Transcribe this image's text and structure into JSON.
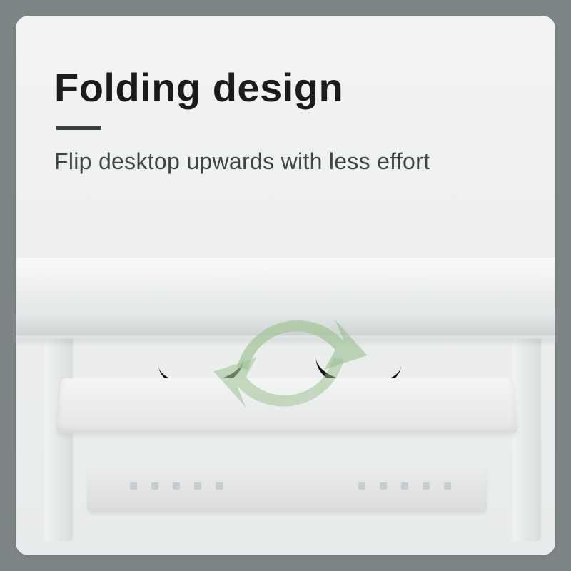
{
  "card": {
    "title": "Folding design",
    "subtitle": "Flip desktop upwards with less effort"
  },
  "colors": {
    "frame_gray": "#7d8587",
    "card_bg_top": "#f2f4f4",
    "card_bg_bottom": "#e9ecec",
    "title_color": "#1b1b1b",
    "subtitle_color": "#3f4446",
    "accent_green": "#99bf8e"
  },
  "icon": {
    "name": "rotate-ring-icon",
    "style": "two-arc arrows, soft green, semi-transparent"
  }
}
